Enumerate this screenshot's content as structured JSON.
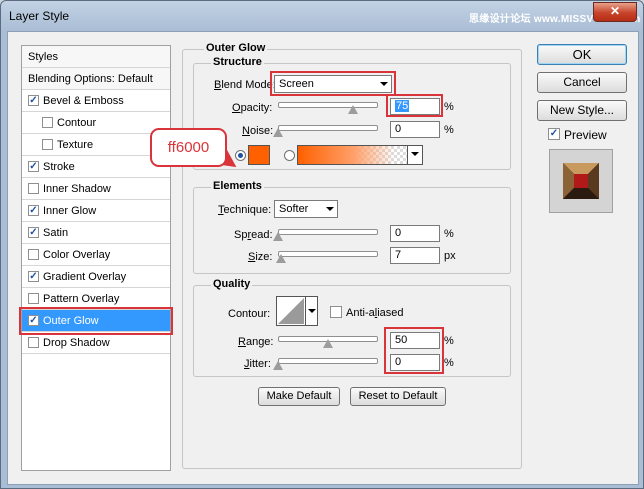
{
  "window": {
    "title": "Layer Style",
    "watermark": "思缘设计论坛 www.MISSVUAN.com",
    "close_glyph": "✕"
  },
  "styles_list": {
    "items": [
      {
        "label": "Styles",
        "type": "header",
        "checked": null
      },
      {
        "label": "Blending Options: Default",
        "type": "header",
        "checked": null
      },
      {
        "label": "Bevel & Emboss",
        "type": "item",
        "checked": true
      },
      {
        "label": "Contour",
        "type": "sub",
        "checked": false
      },
      {
        "label": "Texture",
        "type": "sub",
        "checked": false
      },
      {
        "label": "Stroke",
        "type": "item",
        "checked": true
      },
      {
        "label": "Inner Shadow",
        "type": "item",
        "checked": false
      },
      {
        "label": "Inner Glow",
        "type": "item",
        "checked": true
      },
      {
        "label": "Satin",
        "type": "item",
        "checked": true
      },
      {
        "label": "Color Overlay",
        "type": "item",
        "checked": false
      },
      {
        "label": "Gradient Overlay",
        "type": "item",
        "checked": true
      },
      {
        "label": "Pattern Overlay",
        "type": "item",
        "checked": false
      },
      {
        "label": "Outer Glow",
        "type": "item",
        "checked": true,
        "selected": true
      },
      {
        "label": "Drop Shadow",
        "type": "item",
        "checked": false
      }
    ]
  },
  "outer_glow": {
    "title": "Outer Glow",
    "structure": {
      "title": "Structure",
      "blend_mode_label": "Blend Mode:",
      "blend_mode_value": "Screen",
      "opacity_label": "Opacity:",
      "opacity_value": "75",
      "opacity_slider": 0.75,
      "noise_label": "Noise:",
      "noise_value": "0",
      "noise_slider": 0,
      "color_hex": "#ff6000",
      "percent": "%"
    },
    "elements": {
      "title": "Elements",
      "technique_label": "Technique:",
      "technique_value": "Softer",
      "spread_label": "Spread:",
      "spread_value": "0",
      "spread_slider": 0,
      "size_label": "Size:",
      "size_value": "7",
      "size_slider": 0.03,
      "percent": "%",
      "px": "px"
    },
    "quality": {
      "title": "Quality",
      "contour_label": "Contour:",
      "anti_aliased_label": "Anti-aliased",
      "anti_aliased": false,
      "range_label": "Range:",
      "range_value": "50",
      "range_slider": 0.5,
      "jitter_label": "Jitter:",
      "jitter_value": "0",
      "jitter_slider": 0,
      "percent": "%"
    },
    "make_default_label": "Make Default",
    "reset_default_label": "Reset to Default"
  },
  "right_buttons": {
    "ok_label": "OK",
    "cancel_label": "Cancel",
    "new_style_label": "New Style...",
    "preview_label": "Preview",
    "preview_checked": true
  },
  "annotation": {
    "callout_text": "ff6000"
  },
  "colors": {
    "accent": "#3399ff",
    "annotation_red": "#d9343a",
    "glow": "#ff6000"
  }
}
